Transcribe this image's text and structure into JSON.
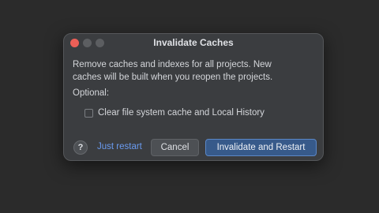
{
  "window": {
    "title": "Invalidate Caches"
  },
  "dialog": {
    "message_line1": "Remove caches and indexes for all projects. New",
    "message_line2": "caches will be built when you reopen the projects.",
    "optional_label": "Optional:",
    "checkbox": {
      "label": "Clear file system cache and Local History",
      "checked": false
    }
  },
  "footer": {
    "help_glyph": "?",
    "just_restart_label": "Just restart",
    "cancel_label": "Cancel",
    "primary_label": "Invalidate and Restart"
  },
  "colors": {
    "link": "#6a9bf0",
    "primary_button": "#375a8a",
    "close_dot": "#ec5f57"
  }
}
